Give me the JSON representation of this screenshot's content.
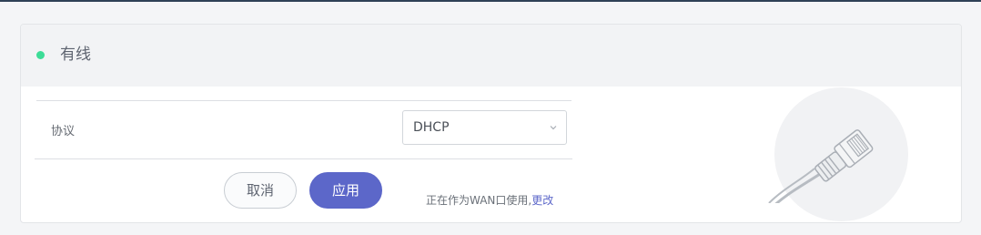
{
  "header": {
    "title": "有线",
    "status_color": "#3ddc97"
  },
  "form": {
    "protocol_label": "协议",
    "protocol_value": "DHCP"
  },
  "actions": {
    "cancel_label": "取消",
    "apply_label": "应用",
    "accent_color": "#5c67c9"
  },
  "note": {
    "text": "正在作为WAN口使用,",
    "link": "更改"
  },
  "illustration": {
    "icon": "ethernet-cable-icon"
  }
}
